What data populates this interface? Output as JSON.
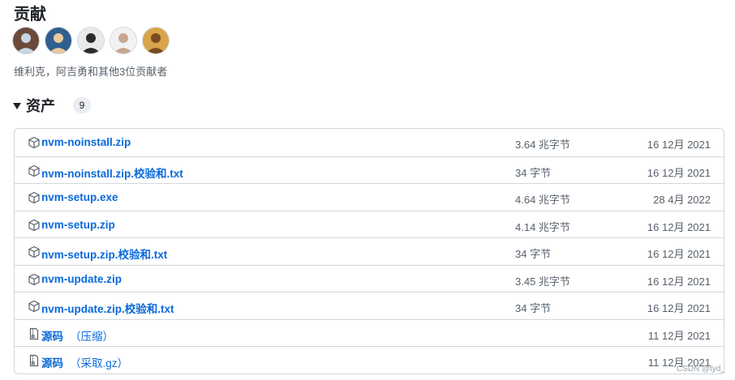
{
  "contributors": {
    "title": "贡献",
    "avatars": [
      {
        "name": "avatar-1",
        "bg": "#6b4a3a",
        "fg": "#c9d6e3"
      },
      {
        "name": "avatar-2",
        "bg": "#2f5f8f",
        "fg": "#e8c9a0"
      },
      {
        "name": "avatar-3",
        "bg": "#e9e9e9",
        "fg": "#2b2b2b"
      },
      {
        "name": "avatar-4",
        "bg": "#f2f2f2",
        "fg": "#c9a78f"
      },
      {
        "name": "avatar-5",
        "bg": "#d9a54a",
        "fg": "#7a4a22"
      }
    ],
    "summary": "维利克，阿吉勇和其他3位贡献者"
  },
  "assets": {
    "title": "资产",
    "count": "9",
    "items": [
      {
        "name": "nvm-noinstall.zip",
        "suffix": "",
        "size": "3.64 兆字节",
        "date": "16 12月 2021",
        "icon": "package-icon"
      },
      {
        "name": "nvm-noinstall.zip.校验和.txt",
        "suffix": "",
        "size": "34 字节",
        "date": "16 12月 2021",
        "icon": "package-icon"
      },
      {
        "name": "nvm-setup.exe",
        "suffix": "",
        "size": "4.64 兆字节",
        "date": "28 4月 2022",
        "icon": "package-icon"
      },
      {
        "name": "nvm-setup.zip",
        "suffix": "",
        "size": "4.14 兆字节",
        "date": "16 12月 2021",
        "icon": "package-icon"
      },
      {
        "name": "nvm-setup.zip.校验和.txt",
        "suffix": "",
        "size": "34 字节",
        "date": "16 12月 2021",
        "icon": "package-icon"
      },
      {
        "name": "nvm-update.zip",
        "suffix": "",
        "size": "3.45 兆字节",
        "date": "16 12月 2021",
        "icon": "package-icon"
      },
      {
        "name": "nvm-update.zip.校验和.txt",
        "suffix": "",
        "size": "34 字节",
        "date": "16 12月 2021",
        "icon": "package-icon"
      },
      {
        "name": "源码",
        "suffix": "（压缩）",
        "size": "",
        "date": "11 12月 2021",
        "icon": "file-zip-icon"
      },
      {
        "name": "源码",
        "suffix": "（采取.gz）",
        "size": "",
        "date": "11 12月 2021",
        "icon": "file-zip-icon"
      }
    ]
  },
  "watermark": "CSDN @tyd_",
  "colors": {
    "link": "#0969da",
    "muted": "#57606a",
    "border": "#d0d7de"
  }
}
